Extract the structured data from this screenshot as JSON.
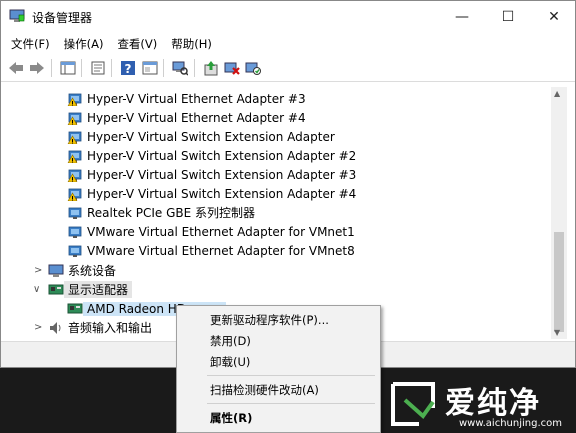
{
  "window": {
    "title": "设备管理器"
  },
  "menu": [
    "文件(F)",
    "操作(A)",
    "查看(V)",
    "帮助(H)"
  ],
  "tree": {
    "items": [
      {
        "label": "Hyper-V Virtual Ethernet Adapter #3",
        "warn": true
      },
      {
        "label": "Hyper-V Virtual Ethernet Adapter #4",
        "warn": true
      },
      {
        "label": "Hyper-V Virtual Switch Extension Adapter",
        "warn": true
      },
      {
        "label": "Hyper-V Virtual Switch Extension Adapter #2",
        "warn": true
      },
      {
        "label": "Hyper-V Virtual Switch Extension Adapter #3",
        "warn": true
      },
      {
        "label": "Hyper-V Virtual Switch Extension Adapter #4",
        "warn": true
      },
      {
        "label": "Realtek PCIe GBE 系列控制器",
        "warn": false
      },
      {
        "label": "VMware Virtual Ethernet Adapter for VMnet1",
        "warn": false
      },
      {
        "label": "VMware Virtual Ethernet Adapter for VMnet8",
        "warn": false
      }
    ],
    "system_devices": "系统设备",
    "display_adapters": "显示适配器",
    "amd_device": "AMD Radeon HD",
    "audio": "音频输入和输出"
  },
  "context_menu": {
    "update_driver": "更新驱动程序软件(P)...",
    "disable": "禁用(D)",
    "uninstall": "卸载(U)",
    "scan": "扫描检测硬件改动(A)",
    "properties": "属性(R)"
  },
  "watermark": {
    "brand": "爱纯净",
    "url": "www.aichunjing.com"
  },
  "colors": {
    "warn": "#f2c200",
    "net": "#3a7ec6",
    "accent": "#2f6fb4"
  }
}
